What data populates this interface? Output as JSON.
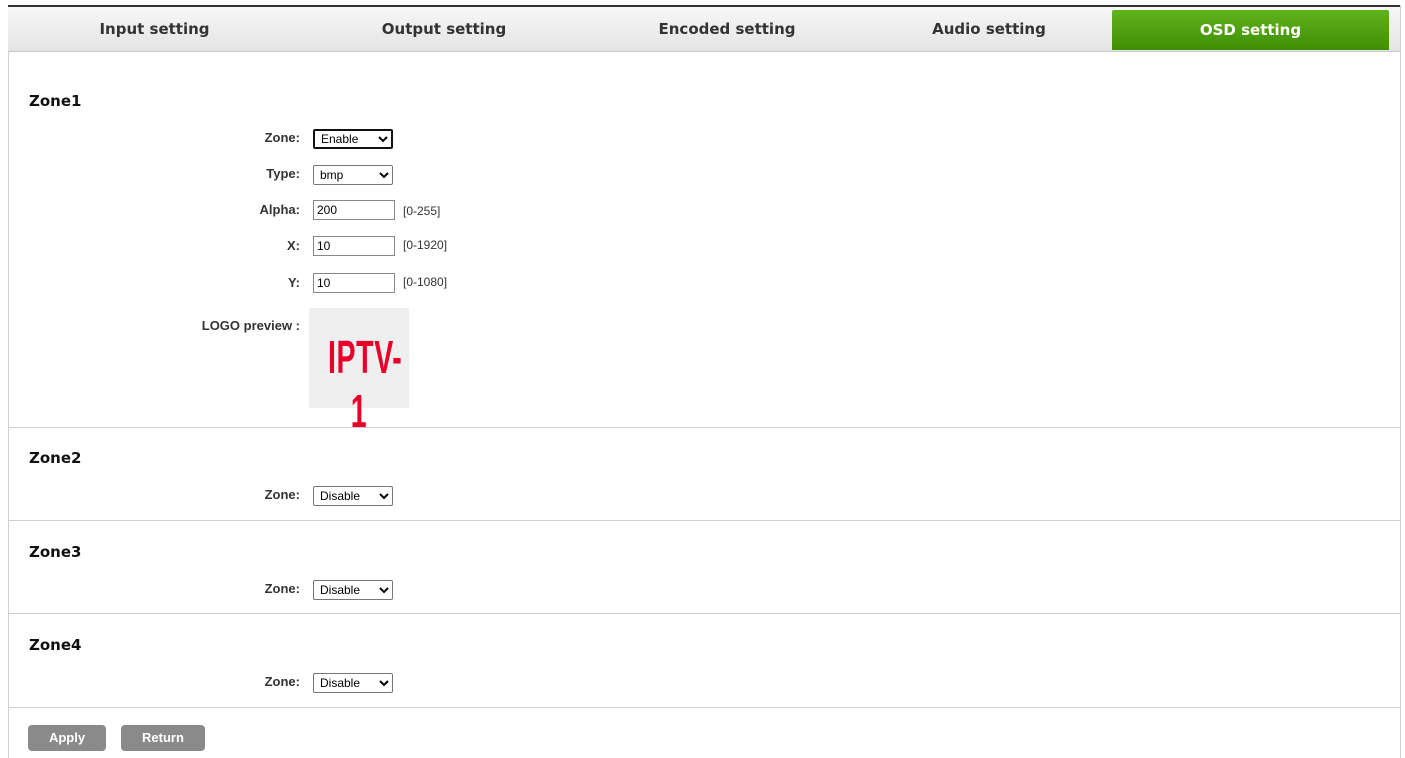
{
  "tabs": [
    {
      "label": "Input setting",
      "active": false
    },
    {
      "label": "Output setting",
      "active": false
    },
    {
      "label": "Encoded setting",
      "active": false
    },
    {
      "label": "Audio setting",
      "active": false
    },
    {
      "label": "OSD setting",
      "active": true
    }
  ],
  "colors": {
    "active_tab": "#4a9c0c",
    "logo_text": "#e8002a",
    "button": "#8a8a8a"
  },
  "zone1": {
    "title": "Zone1",
    "zone_label": "Zone:",
    "zone_value": "Enable",
    "zone_options": [
      "Enable",
      "Disable"
    ],
    "type_label": "Type:",
    "type_value": "bmp",
    "type_options": [
      "bmp"
    ],
    "alpha_label": "Alpha:",
    "alpha_value": "200",
    "alpha_range": "[0-255]",
    "x_label": "X:",
    "x_value": "10",
    "x_range": "[0-1920]",
    "y_label": "Y:",
    "y_value": "10",
    "y_range": "[0-1080]",
    "logo_label": "LOGO preview :",
    "logo_text": "IPTV-1"
  },
  "zone2": {
    "title": "Zone2",
    "zone_label": "Zone:",
    "zone_value": "Disable",
    "zone_options": [
      "Enable",
      "Disable"
    ]
  },
  "zone3": {
    "title": "Zone3",
    "zone_label": "Zone:",
    "zone_value": "Disable",
    "zone_options": [
      "Enable",
      "Disable"
    ]
  },
  "zone4": {
    "title": "Zone4",
    "zone_label": "Zone:",
    "zone_value": "Disable",
    "zone_options": [
      "Enable",
      "Disable"
    ]
  },
  "buttons": {
    "apply": "Apply",
    "return": "Return"
  }
}
